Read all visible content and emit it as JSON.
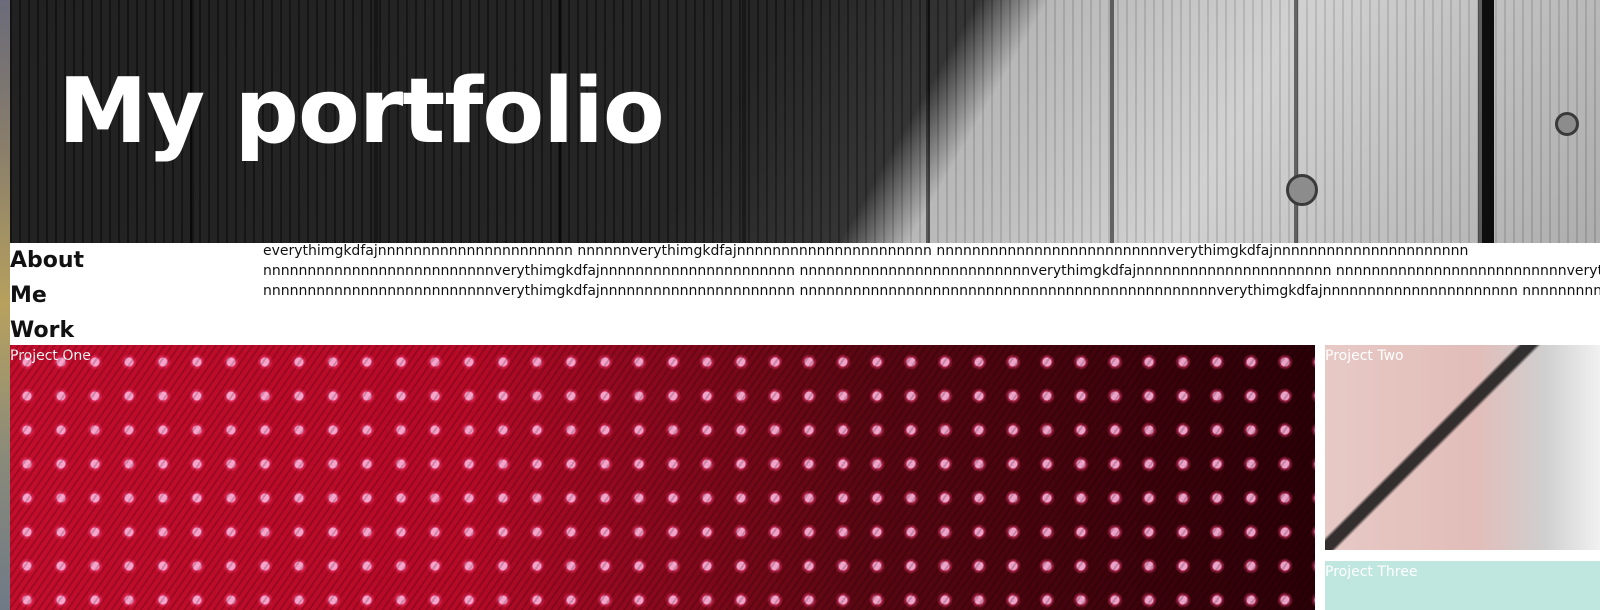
{
  "hero": {
    "title": "My portfolio"
  },
  "nav": {
    "items": [
      {
        "label": "About"
      },
      {
        "label": "Me"
      },
      {
        "label": "Work"
      }
    ]
  },
  "intro": {
    "lines": [
      "everythimgkdfajnnnnnnnnnnnnnnnnnnnnnn nnnnnnverythimgkdfajnnnnnnnnnnnnnnnnnnnnnn nnnnnnnnnnnnnnnnnnnnnnnnnnverythimgkdfajnnnnnnnnnnnnnnnnnnnnnn",
      "nnnnnnnnnnnnnnnnnnnnnnnnnnverythimgkdfajnnnnnnnnnnnnnnnnnnnnnn nnnnnnnnnnnnnnnnnnnnnnnnnnverythimgkdfajnnnnnnnnnnnnnnnnnnnnnn nnnnnnnnnnnnnnnnnnnnnnnnnnveryt",
      "nnnnnnnnnnnnnnnnnnnnnnnnnnverythimgkdfajnnnnnnnnnnnnnnnnnnnnnn nnnnnnnnnnnnnnnnnnnnnnnnnnnnnnnnnnnnnnnnnnnnnnnverythimgkdfajnnnnnnnnnnnnnnnnnnnnnn nnnnnnnnnn"
    ]
  },
  "projects": [
    {
      "label": "Project One"
    },
    {
      "label": "Project Two"
    },
    {
      "label": "Project Three"
    }
  ]
}
